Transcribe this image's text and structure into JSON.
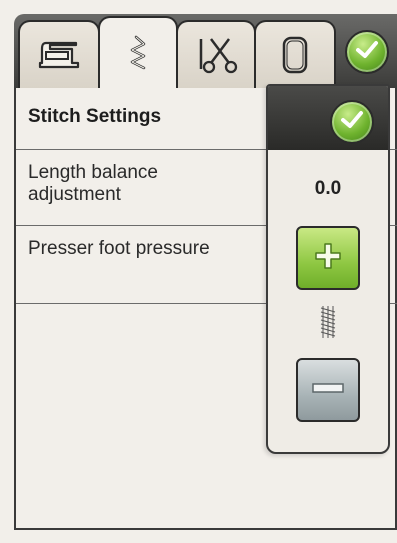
{
  "tabs": [
    {
      "icon": "sewing-machine-icon",
      "active": false
    },
    {
      "icon": "stitch-zigzag-icon",
      "active": true
    },
    {
      "icon": "scissors-needle-icon",
      "active": false
    },
    {
      "icon": "hoop-icon",
      "active": false
    }
  ],
  "confirm_icon": "checkmark-icon",
  "panel": {
    "title": "Stitch Settings",
    "rows": [
      {
        "label": "Length balance adjustment"
      },
      {
        "label": "Presser foot pressure"
      }
    ]
  },
  "popup": {
    "confirm_icon": "checkmark-icon",
    "value": "0.0",
    "increase_icon": "plus-icon",
    "decrease_icon": "minus-icon",
    "stitch_preview_icon": "stitch-density-icon"
  },
  "colors": {
    "accent_green": "#8ec742",
    "header_dark": "#3c3c3a",
    "panel_bg": "#f2efea"
  }
}
